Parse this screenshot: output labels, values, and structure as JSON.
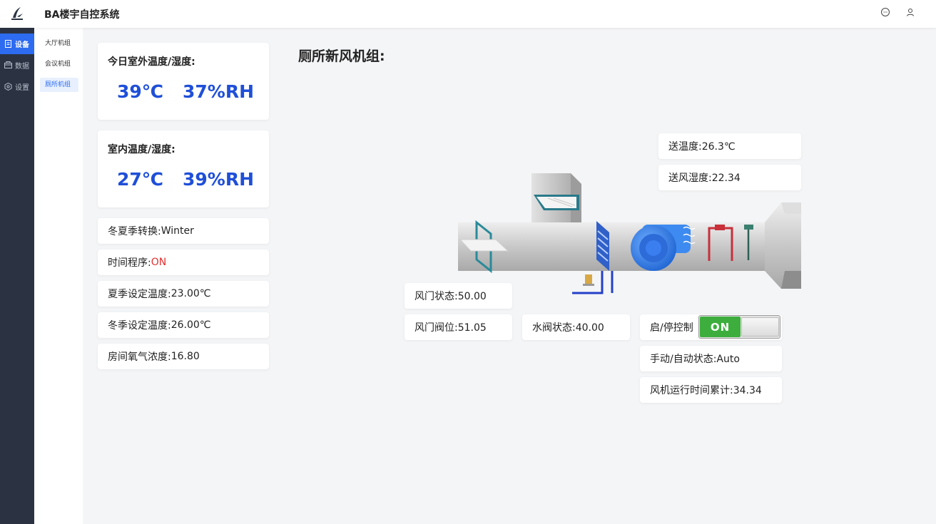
{
  "header": {
    "title": "BA楼宇自控系统"
  },
  "sidebar": {
    "items": [
      {
        "label": "设备",
        "icon": "document-icon",
        "active": true
      },
      {
        "label": "数据",
        "icon": "database-icon",
        "active": false
      },
      {
        "label": "设置",
        "icon": "settings-icon",
        "active": false
      }
    ]
  },
  "submenu": {
    "items": [
      {
        "label": "大厅机组"
      },
      {
        "label": "会议机组"
      },
      {
        "label": "厕所机组"
      }
    ]
  },
  "outdoor": {
    "title": "今日室外温度/湿度:",
    "temp": "39℃",
    "humidity": "37%RH"
  },
  "indoor": {
    "title": "室内温度/湿度:",
    "temp": "27℃",
    "humidity": "39%RH"
  },
  "status_rows": {
    "season_label": "冬夏季转换:",
    "season_value": "Winter",
    "schedule_label": "时间程序:",
    "schedule_value": "ON",
    "summer_label": "夏季设定温度:",
    "summer_value": "23.00℃",
    "winter_label": "冬季设定温度:",
    "winter_value": "26.00℃",
    "oxygen_label": "房间氧气浓度:",
    "oxygen_value": "16.80"
  },
  "unit": {
    "title": "厕所新风机组:",
    "supply_temp": "送温度:26.3℃",
    "supply_humidity": "送风湿度:22.34",
    "damper_status": "风门状态:50.00",
    "damper_position": "风门阀位:51.05",
    "valve_status": "水阀状态:40.00",
    "start_stop_label": "启/停控制",
    "toggle_value": "ON",
    "mode_status": "手动/自动状态:Auto",
    "fan_runtime": "风机运行时间累计:34.34"
  },
  "colors": {
    "accent": "#2d6bf0",
    "value_blue": "#1f4fd8",
    "on_red": "#e03030",
    "toggle_green": "#3dae3d",
    "sidebar_bg": "#2b3343"
  }
}
